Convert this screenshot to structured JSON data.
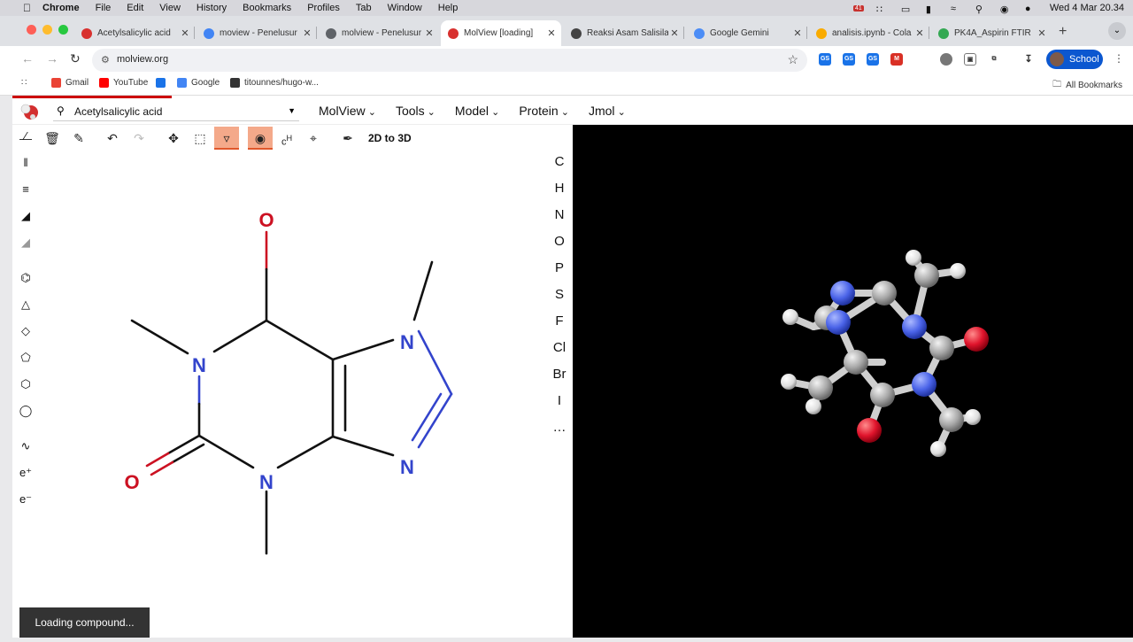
{
  "menubar": {
    "app": "Chrome",
    "items": [
      "File",
      "Edit",
      "View",
      "History",
      "Bookmarks",
      "Profiles",
      "Tab",
      "Window",
      "Help"
    ],
    "clock": "Wed 4 Mar  20.34",
    "badge": "41"
  },
  "tabs": [
    {
      "title": "Acetylsalicylic acid",
      "color": "#d8312f"
    },
    {
      "title": "moview - Penelusur",
      "color": "#4285f4"
    },
    {
      "title": "molview - Penelusur",
      "color": "#5f6368"
    },
    {
      "title": "MolView [loading]",
      "color": "#d8312f"
    },
    {
      "title": "Reaksi Asam Salisila",
      "color": "#444444"
    },
    {
      "title": "Google Gemini",
      "color": "#4c8df6"
    },
    {
      "title": "analisis.ipynb - Cola",
      "color": "#f9ab00"
    },
    {
      "title": "PK4A_Aspirin FTIR",
      "color": "#34a853"
    }
  ],
  "omnibox": {
    "url": "molview.org"
  },
  "extensions": [
    "GS",
    "GS",
    "GS",
    "M"
  ],
  "profile": {
    "label": "School"
  },
  "bookmarks": [
    {
      "label": "Gmail",
      "color": "#ea4335"
    },
    {
      "label": "YouTube",
      "color": "#ff0000"
    },
    {
      "label": "",
      "color": "#1a73e8"
    },
    {
      "label": "Google",
      "color": "#4285f4"
    },
    {
      "label": "titounnes/hugo-w...",
      "color": "#333333"
    }
  ],
  "all_bookmarks": "All Bookmarks",
  "app": {
    "search_value": "Acetylsalicylic acid",
    "menus": [
      "MolView",
      "Tools",
      "Model",
      "Protein",
      "Jmol"
    ],
    "convert_button": "2D to 3D",
    "elements": [
      "C",
      "H",
      "N",
      "O",
      "P",
      "S",
      "F",
      "Cl",
      "Br",
      "I",
      "…"
    ],
    "charges": [
      "e⁺",
      "e⁻"
    ],
    "atoms_2d": {
      "o_top": "O",
      "n1": "N",
      "n_top": "N",
      "n_right": "N",
      "o_left": "O",
      "n3": "N"
    },
    "toast": "Loading compound..."
  }
}
